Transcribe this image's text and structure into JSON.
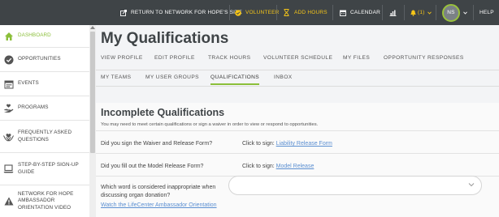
{
  "topbar": {
    "return_label": "RETURN TO NETWORK FOR HOPE'S SITE",
    "volunteer_label": "VOLUNTEER",
    "add_hours_label": "ADD HOURS",
    "calendar_label": "CALENDAR",
    "notifications_label": "(1)",
    "avatar_initials": "NS",
    "help_label": "HELP",
    "colors": {
      "bar": "#3f4447",
      "accent": "#f5c518",
      "avatar_ring": "#9ac23c"
    }
  },
  "sidebar": {
    "items": [
      {
        "label": "DASHBOARD",
        "icon": "home-icon",
        "active": true
      },
      {
        "label": "OPPORTUNITIES",
        "icon": "check-circle-icon"
      },
      {
        "label": "EVENTS",
        "icon": "calendar-icon"
      },
      {
        "label": "PROGRAMS",
        "icon": "hand-heart-icon"
      },
      {
        "label": "FREQUENTLY ASKED QUESTIONS",
        "icon": "heart-hands-icon"
      },
      {
        "label": "STEP-BY-STEP SIGN-UP GUIDE",
        "icon": "laptop-icon"
      },
      {
        "label": "NETWORK FOR HOPE AMBASSADOR ORIENTATION VIDEO",
        "icon": "warning-icon"
      }
    ],
    "active_color": "#8bbf3a"
  },
  "main": {
    "title": "My Qualifications",
    "tabs_row1": [
      "VIEW PROFILE",
      "EDIT PROFILE",
      "TRACK HOURS",
      "VOLUNTEER SCHEDULE",
      "MY FILES",
      "OPPORTUNITY RESPONSES"
    ],
    "tabs_row2": [
      "MY TEAMS",
      "MY USER GROUPS",
      "QUALIFICATIONS",
      "INBOX"
    ],
    "active_tab": "QUALIFICATIONS"
  },
  "incomplete": {
    "title": "Incomplete Qualifications",
    "description": "You may need to meet certain qualifications or sign a waiver in order to view or respond to opportunities.",
    "rows": [
      {
        "question": "Did you sign the Waiver and Release Form?",
        "prefix": "Click to sign:",
        "link": "Liability Release Form"
      },
      {
        "question": "Did you fill out the Model Release Form?",
        "prefix": "Click to sign:",
        "link": "Model Release"
      }
    ],
    "question3": "Which word is considered inappropriate when discussing organ donation?",
    "question3_link": "Watch the LifeCenter Ambassador Orientation",
    "select_value": ""
  }
}
